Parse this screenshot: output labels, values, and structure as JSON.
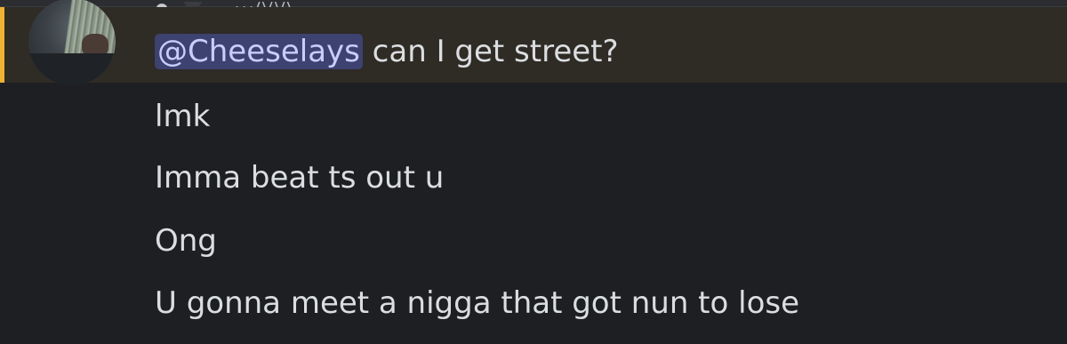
{
  "header": {
    "timestamp_fragment": "...ΛΛΛ"
  },
  "messages": {
    "first": {
      "mention": "@Cheeselays",
      "text": " can I get street?"
    },
    "lines": [
      "lmk",
      "Imma beat ts out u",
      "Ong",
      "U gonna meet a nigga that got nun to lose"
    ]
  },
  "colors": {
    "background": "#1e1f22",
    "highlight_background": "#2f2b25",
    "highlight_bar": "#f0b232",
    "mention_background": "#3d4270",
    "mention_text": "#c9cdfb",
    "message_text": "#dbdee1"
  }
}
